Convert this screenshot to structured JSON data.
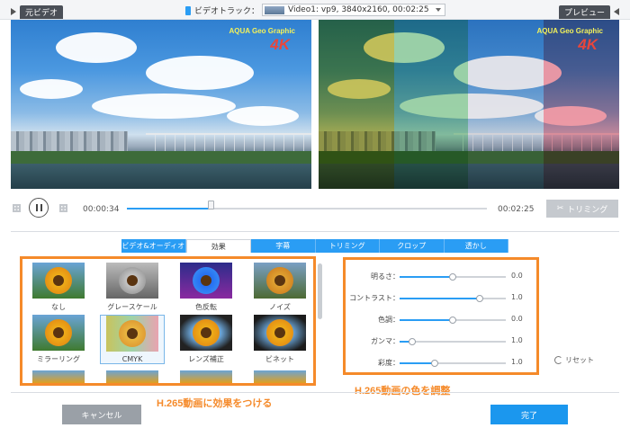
{
  "topbar": {
    "original_tab": "元ビデオ",
    "track_label": "ビデオトラック：",
    "track_value": "Video1: vp9, 3840x2160, 00:02:25",
    "preview_tab": "プレビュー"
  },
  "video": {
    "watermark_text": "AQUA Geo Graphic",
    "watermark_4k": "4K"
  },
  "playback": {
    "current_time": "00:00:34",
    "total_time": "00:02:25",
    "progress_fraction": 0.234,
    "trim_label": "トリミング"
  },
  "edit_tabs": [
    {
      "label": "ビデオ&オーディオ",
      "active": false
    },
    {
      "label": "効果",
      "active": true
    },
    {
      "label": "字幕",
      "active": false
    },
    {
      "label": "トリミング",
      "active": false
    },
    {
      "label": "クロップ",
      "active": false
    },
    {
      "label": "透かし",
      "active": false
    }
  ],
  "effects": [
    {
      "label": "なし",
      "icon": "sunflower-normal"
    },
    {
      "label": "グレースケール",
      "icon": "sunflower-grayscale"
    },
    {
      "label": "色反転",
      "icon": "sunflower-inverted"
    },
    {
      "label": "ノイズ",
      "icon": "sunflower-noise"
    },
    {
      "label": "ミラーリング",
      "icon": "sunflower-mirror"
    },
    {
      "label": "CMYK",
      "icon": "sunflower-cmyk",
      "selected": true
    },
    {
      "label": "レンズ補正",
      "icon": "sunflower-lens"
    },
    {
      "label": "ビネット",
      "icon": "sunflower-vignette"
    }
  ],
  "adjustments": [
    {
      "label": "明るさ：",
      "value": "0.0",
      "level": 0.5
    },
    {
      "label": "コントラスト：",
      "value": "1.0",
      "level": 0.75
    },
    {
      "label": "色調：",
      "value": "0.0",
      "level": 0.5
    },
    {
      "label": "ガンマ：",
      "value": "1.0",
      "level": 0.12
    },
    {
      "label": "彩度：",
      "value": "1.0",
      "level": 0.33
    }
  ],
  "reset_label": "リセット",
  "captions": {
    "effects": "H.265動画に効果をつける",
    "colors": "H.265動画の色を調整"
  },
  "footer": {
    "cancel": "キャンセル",
    "ok": "完了"
  },
  "colors": {
    "accent": "#2a9df4",
    "highlight": "#f58a2a"
  }
}
